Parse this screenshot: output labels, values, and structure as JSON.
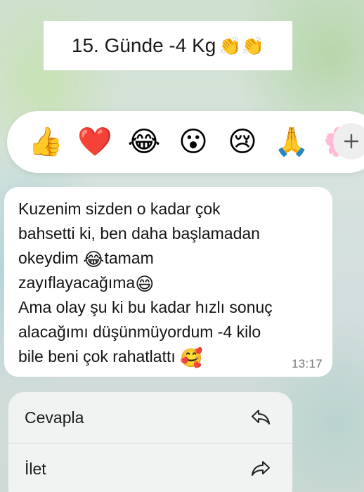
{
  "title_card": {
    "text": "15. Günde -4 Kg",
    "emoji": "👏👏"
  },
  "reaction_bar": {
    "reactions": [
      "👍",
      "❤️",
      "😂",
      "😮",
      "😢",
      "🙏",
      "🌸"
    ],
    "add_icon": "plus-icon"
  },
  "message": {
    "lines": [
      "Kuzenim sizden  o kadar çok",
      "bahsetti ki, ben daha başlamadan",
      "okeydim",
      "tamam",
      "zayıflayacağıma",
      "Ama olay şu ki bu kadar hızlı sonuç",
      "alacağımı düşünmüyordum -4 kilo",
      "bile beni çok rahatlattı"
    ],
    "emojis": {
      "laugh": "😂",
      "smile": "😄",
      "hearts": "🥰"
    },
    "time": "13:17"
  },
  "context_menu": {
    "items": [
      {
        "label": "Cevapla",
        "icon": "reply-icon"
      },
      {
        "label": "İlet",
        "icon": "forward-icon"
      }
    ]
  }
}
